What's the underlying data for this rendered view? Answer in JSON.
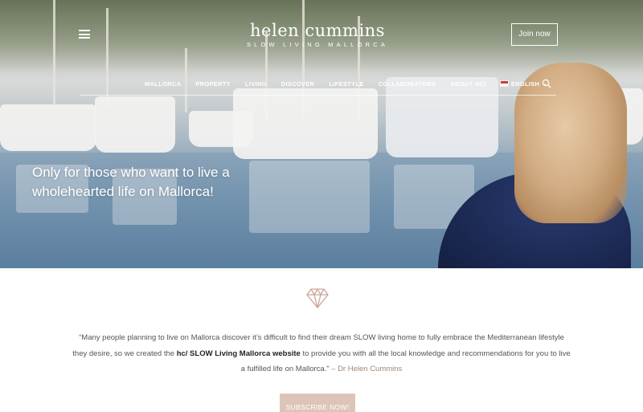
{
  "header": {
    "menu_icon": "hamburger-menu-icon",
    "logo_name": "helen cummins",
    "logo_tagline": "SLOW LIVING MALLORCA",
    "join_label": "Join now",
    "search_icon": "search-icon"
  },
  "nav": {
    "items": [
      "MALLORCA",
      "PROPERTY",
      "LIVING",
      "DISCOVER",
      "LIFESTYLE",
      "COLLABORATORS",
      "ABOUT HC/"
    ],
    "language": "ENGLISH"
  },
  "hero": {
    "headline_line1": "Only for those who want to live a",
    "headline_line2": "wholehearted life on Mallorca!"
  },
  "intro": {
    "icon": "diamond-icon",
    "quote_part1": "“Many people planning to live on Mallorca discover it’s difficult to find their dream SLOW living home to fully embrace the Mediterranean lifestyle they desire, so we created the ",
    "quote_link": "hc/ SLOW Living Mallorca website",
    "quote_part2": " to provide you with all the local knowledge and recommendations for you to live a fulfilled life on Mallorca.” ",
    "author": "– Dr Helen Cummins"
  },
  "cta": {
    "subscribe_label": "SUBSCRIBE NOW!"
  },
  "colors": {
    "accent": "#dcc5b8",
    "author": "#a08878"
  }
}
